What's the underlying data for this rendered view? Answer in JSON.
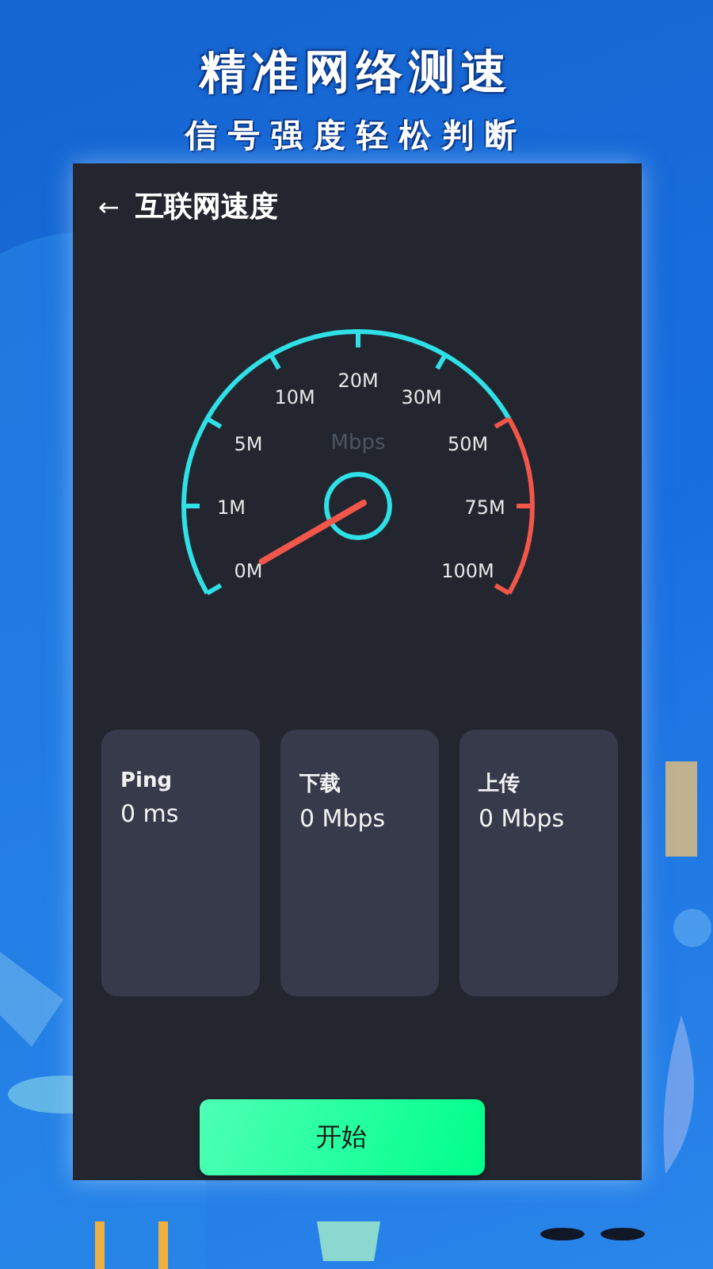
{
  "promo": {
    "headline": "精准网络测速",
    "subline": "信号强度轻松判断"
  },
  "screen": {
    "back": "←",
    "title": "互联网速度"
  },
  "gauge": {
    "unit": "Mbps",
    "ticks": [
      {
        "label": "0M",
        "color": "#2fe0e6"
      },
      {
        "label": "1M",
        "color": "#2fe0e6"
      },
      {
        "label": "5M",
        "color": "#2fe0e6"
      },
      {
        "label": "10M",
        "color": "#2fe0e6"
      },
      {
        "label": "20M",
        "color": "#2fe0e6"
      },
      {
        "label": "30M",
        "color": "#2fe0e6"
      },
      {
        "label": "50M",
        "color": "#f0574a"
      },
      {
        "label": "75M",
        "color": "#f0574a"
      },
      {
        "label": "100M",
        "color": "#f0574a"
      }
    ]
  },
  "stats": [
    {
      "label": "Ping",
      "value": "0 ms"
    },
    {
      "label": "下载",
      "value": "0 Mbps"
    },
    {
      "label": "上传",
      "value": "0 Mbps"
    }
  ],
  "start_button": "开始"
}
